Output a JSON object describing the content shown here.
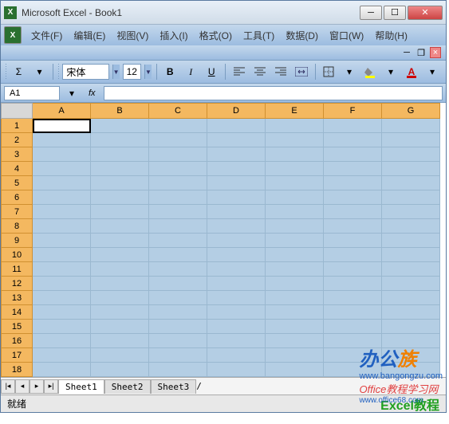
{
  "title": "Microsoft Excel - Book1",
  "menu": {
    "file": "文件(F)",
    "edit": "编辑(E)",
    "view": "视图(V)",
    "insert": "插入(I)",
    "format": "格式(O)",
    "tools": "工具(T)",
    "data": "数据(D)",
    "window": "窗口(W)",
    "help": "帮助(H)"
  },
  "toolbar": {
    "sigma": "Σ",
    "font_name": "宋体",
    "font_size": "12",
    "bold": "B",
    "italic": "I",
    "underline": "U"
  },
  "namebox": {
    "cell_ref": "A1",
    "fx": "fx"
  },
  "columns": [
    "A",
    "B",
    "C",
    "D",
    "E",
    "F",
    "G"
  ],
  "rows": [
    "1",
    "2",
    "3",
    "4",
    "5",
    "6",
    "7",
    "8",
    "9",
    "10",
    "11",
    "12",
    "13",
    "14",
    "15",
    "16",
    "17",
    "18"
  ],
  "sheets": {
    "s1": "Sheet1",
    "s2": "Sheet2",
    "s3": "Sheet3"
  },
  "status": {
    "ready": "就绪",
    "tutorial": "Excel教程"
  },
  "watermark": {
    "brand_prefix": "办公",
    "brand_suffix": "族",
    "url1": "www.bangongzu.com",
    "office_text": "Office教程学习网",
    "url2": "www.office68.com"
  }
}
